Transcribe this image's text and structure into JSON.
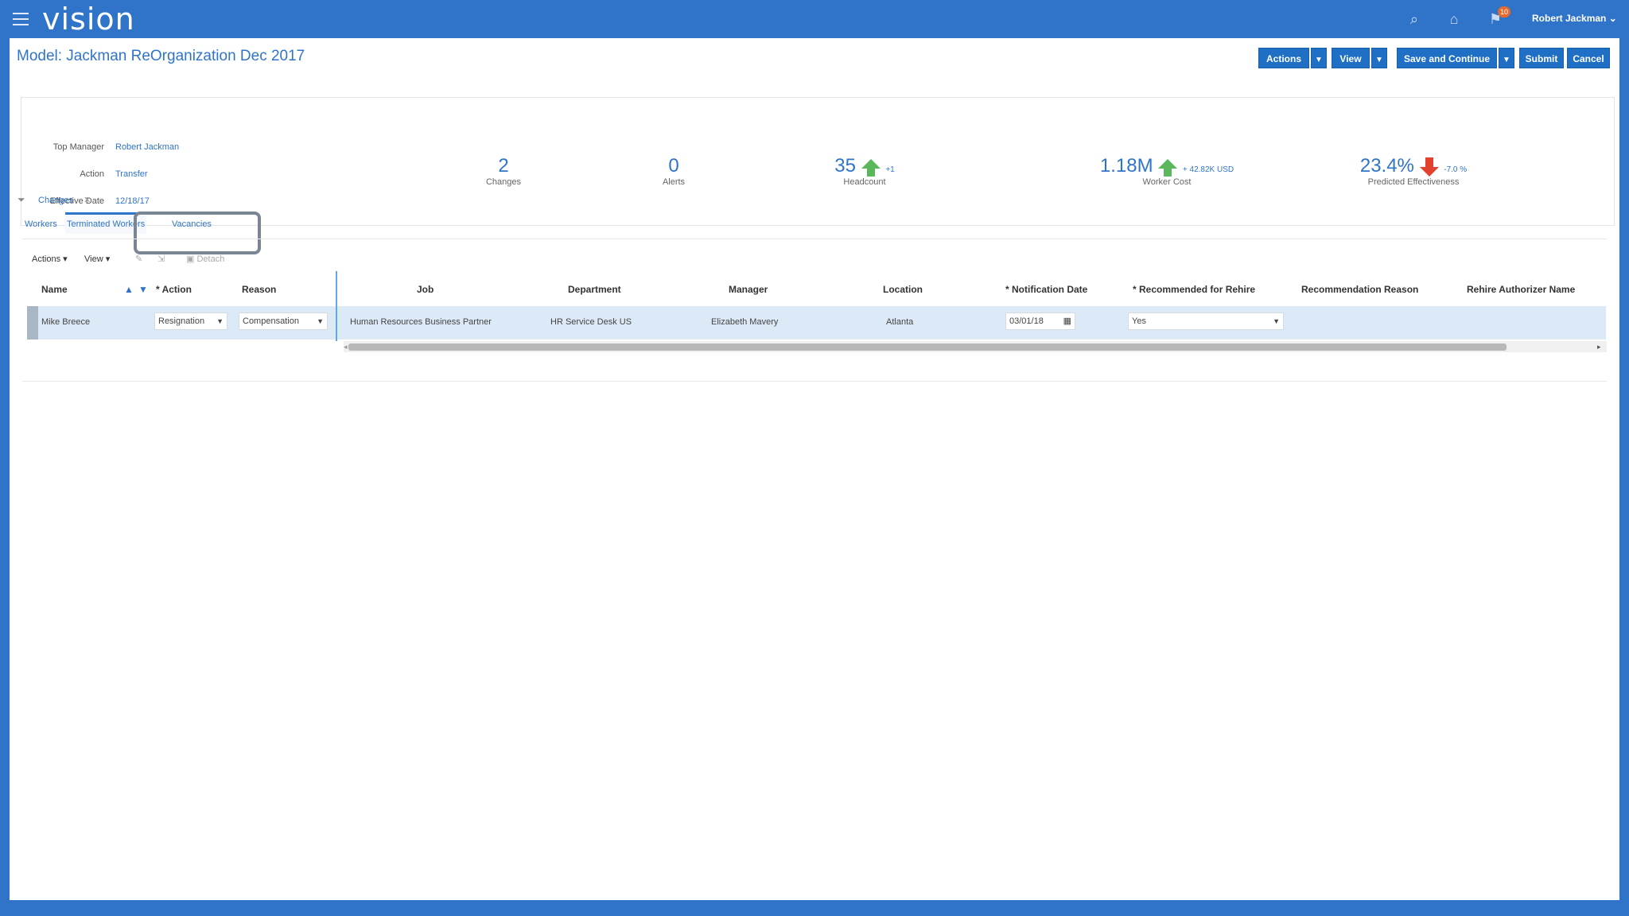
{
  "app": {
    "logo": "vision",
    "user": "Robert Jackman",
    "notification_count": "10"
  },
  "page": {
    "title": "Model: Jackman ReOrganization Dec 2017"
  },
  "toolbar": {
    "actions": "Actions",
    "view": "View",
    "save_continue": "Save and Continue",
    "submit": "Submit",
    "cancel": "Cancel"
  },
  "summary": {
    "fields": [
      {
        "label": "Top Manager",
        "value": "Robert Jackman"
      },
      {
        "label": "Action",
        "value": "Transfer"
      },
      {
        "label": "Effective Date",
        "value": "12/18/17"
      }
    ],
    "metrics": [
      {
        "value": "2",
        "label": "Changes"
      },
      {
        "value": "0",
        "label": "Alerts"
      },
      {
        "value": "35",
        "label": "Headcount",
        "trend": "up",
        "delta": "+1"
      },
      {
        "value": "1.18M",
        "label": "Worker Cost",
        "trend": "up",
        "delta": "+ 42.82K USD"
      },
      {
        "value": "23.4%",
        "label": "Predicted Effectiveness",
        "trend": "down",
        "delta": "-7.0 %"
      }
    ]
  },
  "filter": {
    "chip": "Changes"
  },
  "tabs": [
    "Workers",
    "Terminated Workers",
    "Vacancies"
  ],
  "table_toolbar": {
    "actions": "Actions",
    "view": "View",
    "detach": "Detach"
  },
  "table": {
    "columns": [
      "Name",
      "Action",
      "Reason",
      "Job",
      "Department",
      "Manager",
      "Location",
      "Notification Date",
      "Recommended for Rehire",
      "Recommendation Reason",
      "Rehire Authorizer Name"
    ],
    "rows": [
      {
        "name": "Mike Breece",
        "action": "Resignation",
        "reason": "Compensation",
        "job": "Human Resources Business Partner",
        "department": "HR Service Desk US",
        "manager": "Elizabeth Mavery",
        "location": "Atlanta",
        "notification_date": "03/01/18",
        "rehire": "Yes",
        "recommendation_reason": "",
        "authorizer": ""
      }
    ]
  },
  "colors": {
    "brand": "#2f74c8",
    "up": "#5bb75b",
    "down": "#e0422f"
  }
}
